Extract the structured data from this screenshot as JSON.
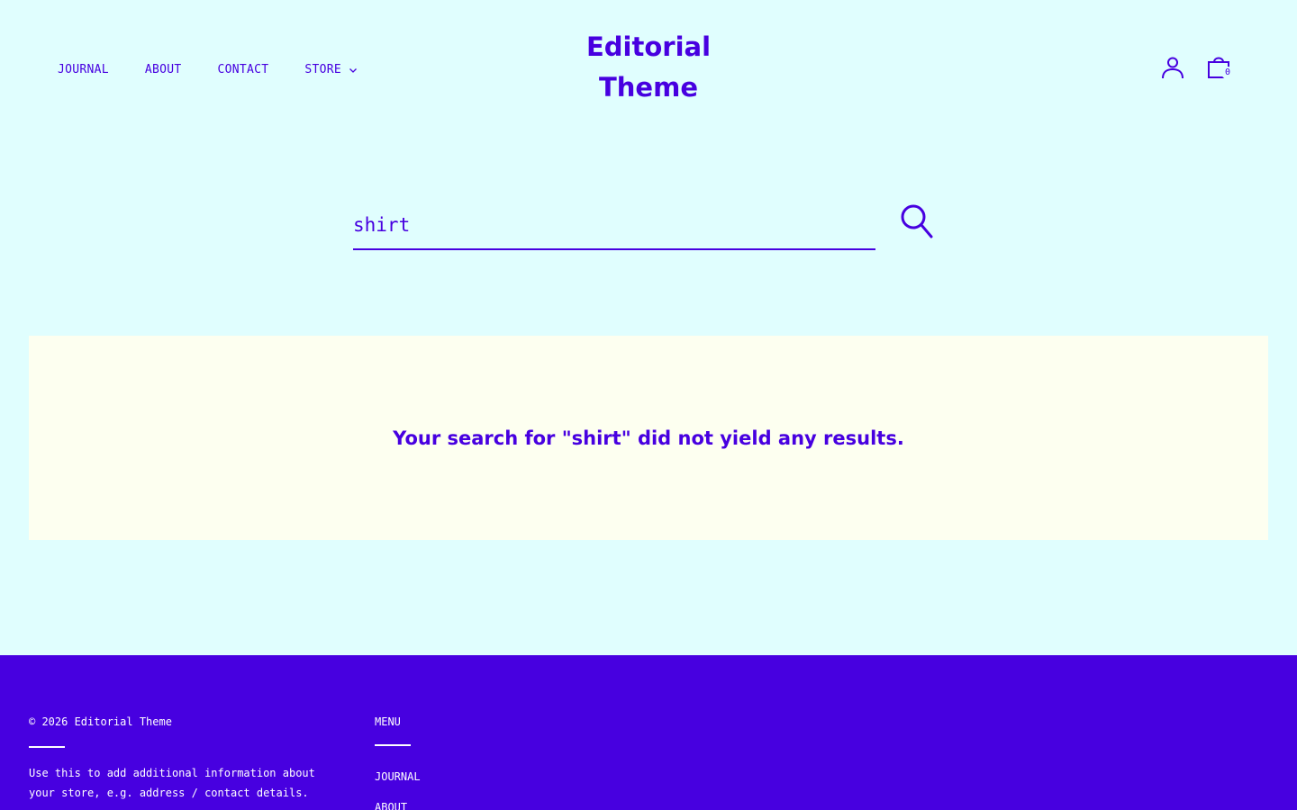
{
  "header": {
    "nav": [
      {
        "label": "JOURNAL"
      },
      {
        "label": "ABOUT"
      },
      {
        "label": "CONTACT"
      },
      {
        "label": "STORE"
      }
    ],
    "logo_line1": "Editorial",
    "logo_line2": "Theme",
    "cart_count": "0"
  },
  "search": {
    "value": "shirt",
    "button_icon": "search-icon"
  },
  "results": {
    "message": "Your search for \"shirt\" did not yield any results."
  },
  "footer": {
    "copyright": "© 2026 Editorial Theme",
    "about_text": "Use this to add additional information about your store, e.g. address / contact details.",
    "menu_heading": "MENU",
    "menu_items": [
      {
        "label": "JOURNAL"
      },
      {
        "label": "ABOUT"
      }
    ]
  },
  "colors": {
    "background": "#e0fefe",
    "accent": "#4700e0",
    "panel": "#fdfff0",
    "footer_text": "#ffffff"
  }
}
